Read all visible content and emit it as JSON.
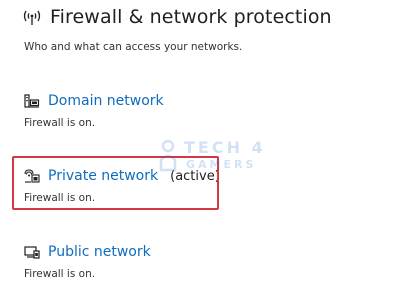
{
  "header": {
    "title": "Firewall & network protection",
    "icon": "wifi-antenna-icon"
  },
  "subtitle": "Who and what can access your networks.",
  "networks": [
    {
      "name": "Domain network",
      "active_label": "",
      "status": "Firewall is on.",
      "icon": "domain-network-icon"
    },
    {
      "name": "Private network",
      "active_label": "(active)",
      "status": "Firewall is on.",
      "icon": "private-network-icon"
    },
    {
      "name": "Public network",
      "active_label": "",
      "status": "Firewall is on.",
      "icon": "public-network-icon"
    }
  ],
  "watermark": {
    "line1": "TECH 4",
    "line2": "GAMERS"
  },
  "colors": {
    "link": "#0f6cbd",
    "highlight": "#d13a42",
    "watermark": "#3a7bd5"
  }
}
